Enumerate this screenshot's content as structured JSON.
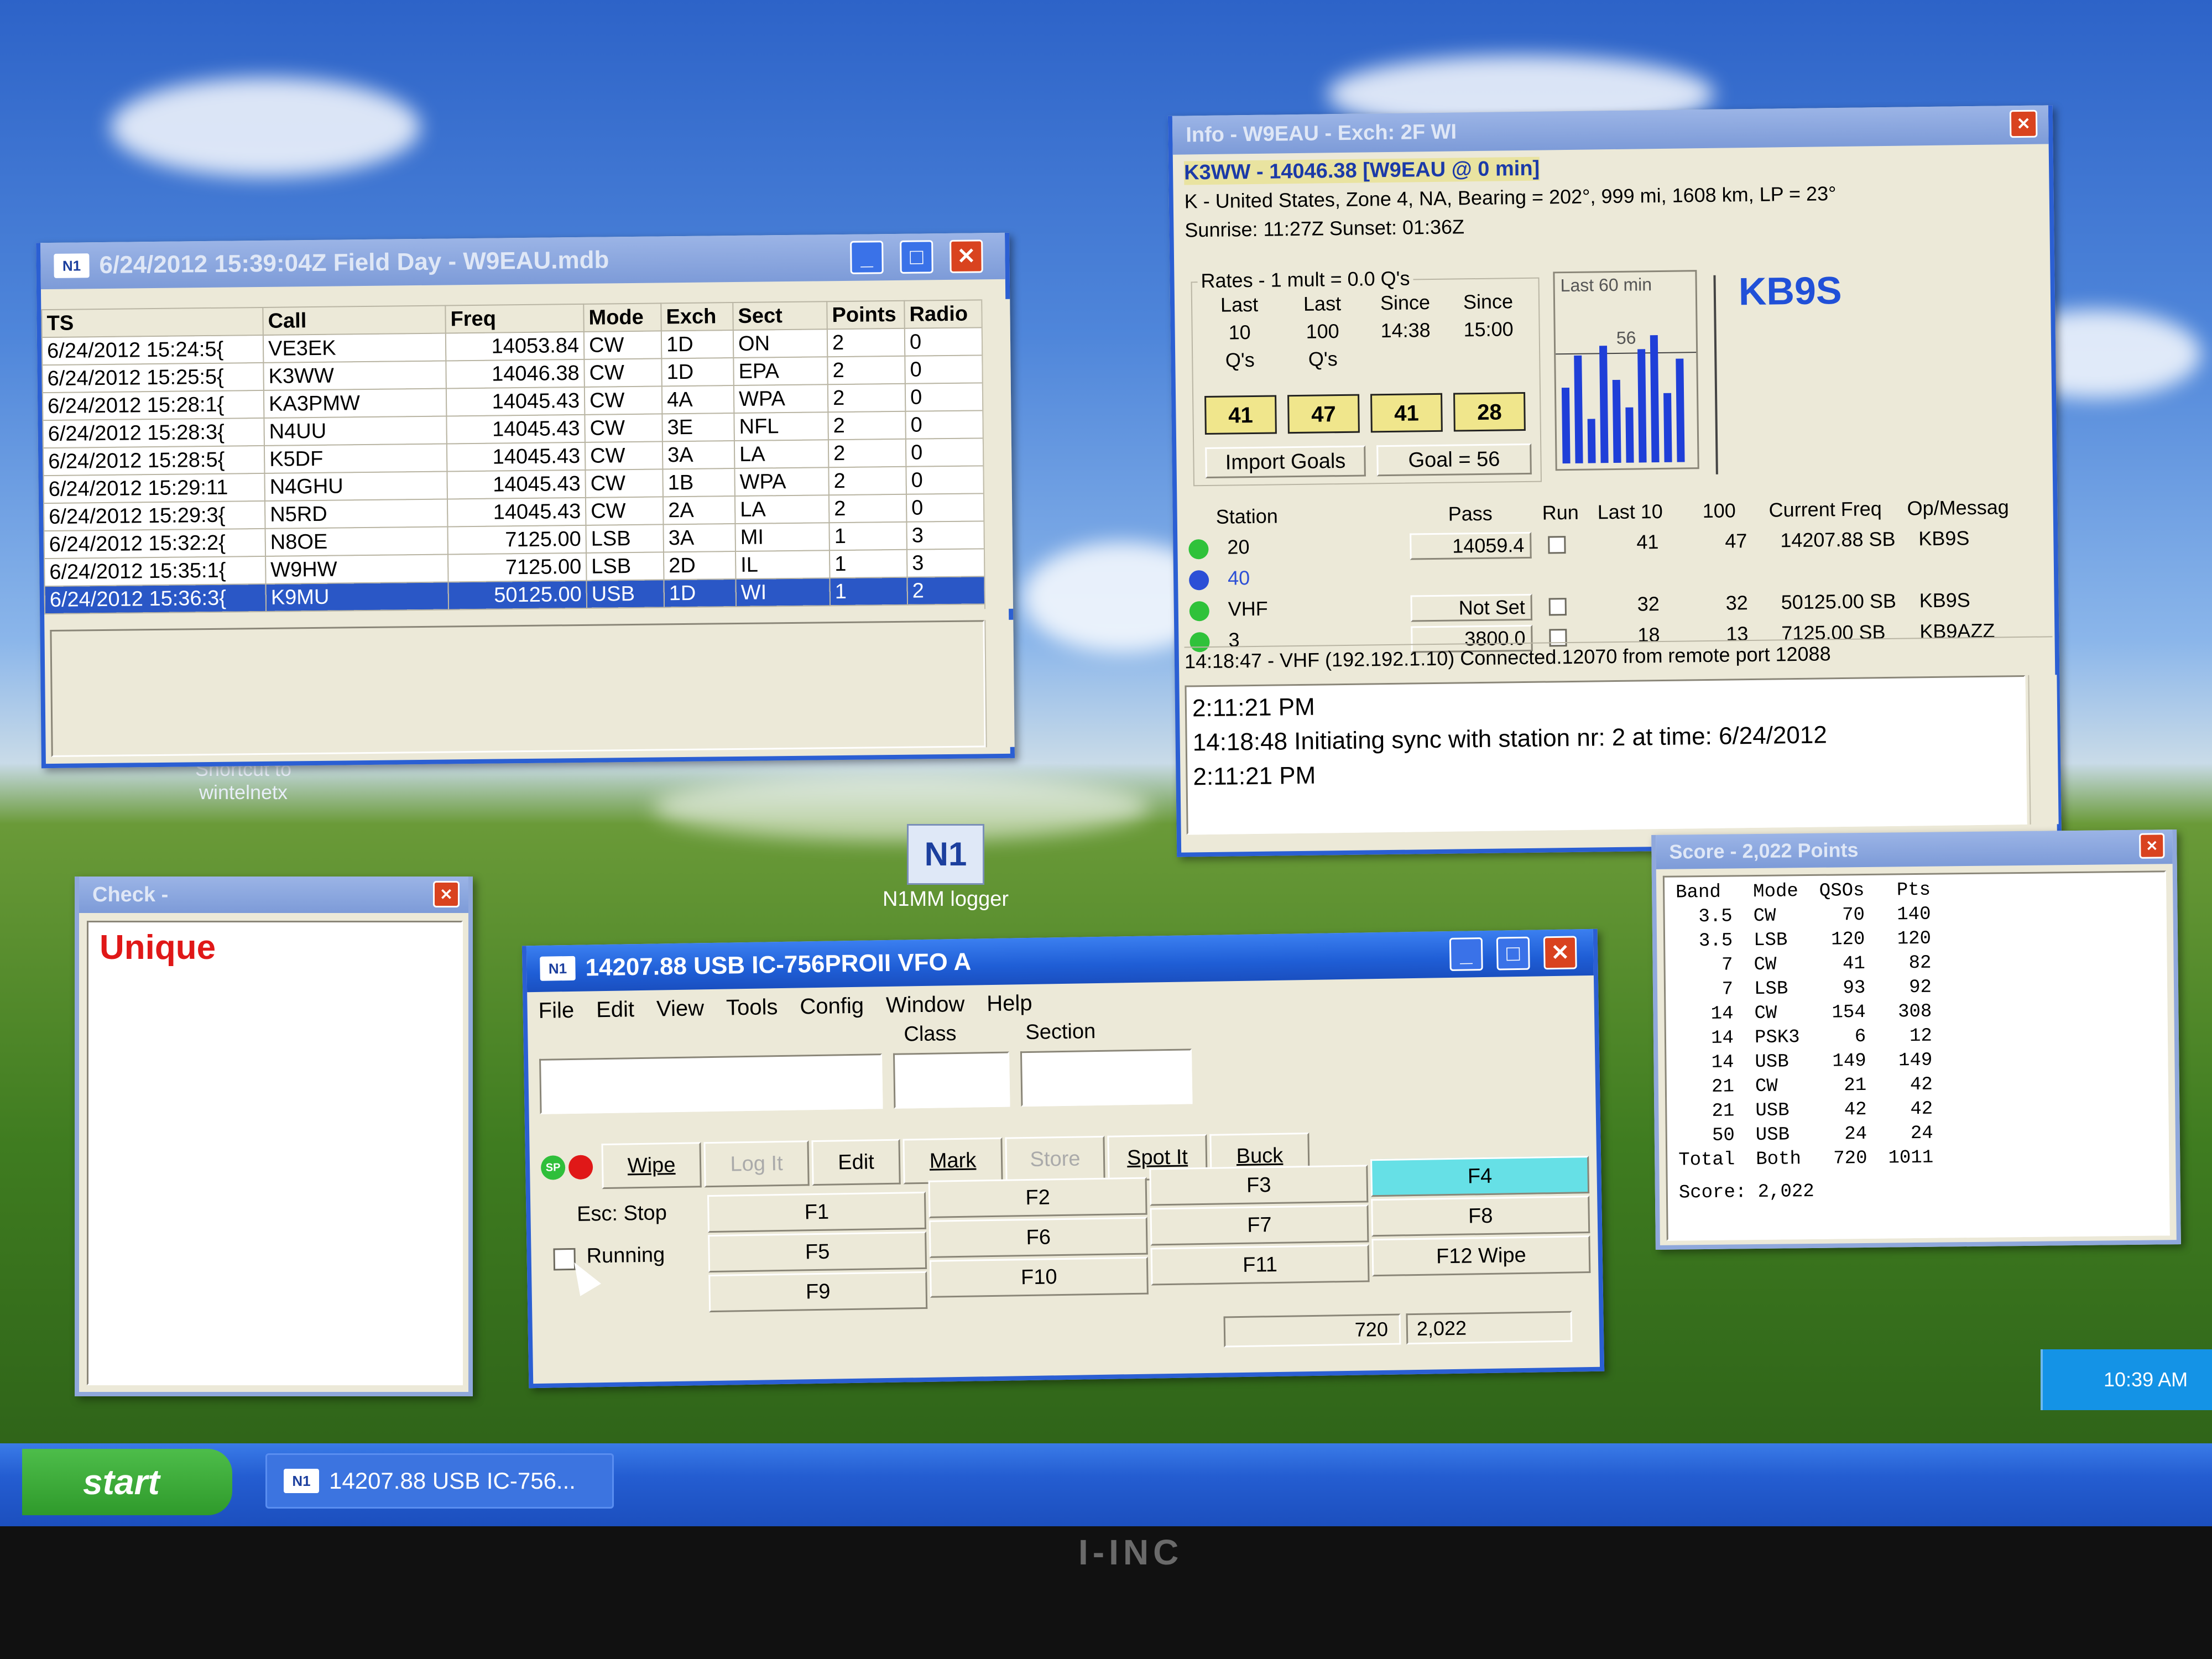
{
  "desktop": {
    "shortcut_winsimplex": "Shortcut to\nwintelnetx",
    "shortcut_n1mm": "N1MM logger"
  },
  "log_window": {
    "title": "6/24/2012 15:39:04Z  Field Day - W9EAU.mdb",
    "columns": [
      "TS",
      "Call",
      "Freq",
      "Mode",
      "Exch",
      "Sect",
      "Points",
      "Radio"
    ],
    "rows": [
      [
        "6/24/2012 15:24:5{",
        "VE3EK",
        "14053.84",
        "CW",
        "1D",
        "ON",
        "2",
        "0"
      ],
      [
        "6/24/2012 15:25:5{",
        "K3WW",
        "14046.38",
        "CW",
        "1D",
        "EPA",
        "2",
        "0"
      ],
      [
        "6/24/2012 15:28:1{",
        "KA3PMW",
        "14045.43",
        "CW",
        "4A",
        "WPA",
        "2",
        "0"
      ],
      [
        "6/24/2012 15:28:3{",
        "N4UU",
        "14045.43",
        "CW",
        "3E",
        "NFL",
        "2",
        "0"
      ],
      [
        "6/24/2012 15:28:5{",
        "K5DF",
        "14045.43",
        "CW",
        "3A",
        "LA",
        "2",
        "0"
      ],
      [
        "6/24/2012 15:29:11",
        "N4GHU",
        "14045.43",
        "CW",
        "1B",
        "WPA",
        "2",
        "0"
      ],
      [
        "6/24/2012 15:29:3{",
        "N5RD",
        "14045.43",
        "CW",
        "2A",
        "LA",
        "2",
        "0"
      ],
      [
        "6/24/2012 15:32:2{",
        "N8OE",
        "7125.00",
        "LSB",
        "3A",
        "MI",
        "1",
        "3"
      ],
      [
        "6/24/2012 15:35:1{",
        "W9HW",
        "7125.00",
        "LSB",
        "2D",
        "IL",
        "1",
        "3"
      ],
      [
        "6/24/2012 15:36:3{",
        "K9MU",
        "50125.00",
        "USB",
        "1D",
        "WI",
        "1",
        "2"
      ]
    ],
    "selected_row": 9
  },
  "info_window": {
    "title": "Info - W9EAU - Exch: 2F WI",
    "spot_line": "K3WW - 14046.38 [W9EAU @ 0 min]",
    "country_line": "K - United States, Zone 4, NA, Bearing = 202°, 999  mi, 1608 km, LP = 23°",
    "sun_line": "Sunrise: 11:27Z   Sunset: 01:36Z",
    "rates_label": "Rates - 1 mult = 0.0 Q's",
    "rate_headers": [
      [
        "Last",
        "10",
        "Q's"
      ],
      [
        "Last",
        "100",
        "Q's"
      ],
      [
        "Since",
        "14:38",
        ""
      ],
      [
        "Since",
        "15:00",
        ""
      ]
    ],
    "rate_values": [
      "41",
      "47",
      "41",
      "28"
    ],
    "import_goals": "Import Goals",
    "goal": "Goal = 56",
    "graph_label": "Last 60 min",
    "graph_goal": "56",
    "graph_bars": [
      0.55,
      0.78,
      0.32,
      0.85,
      0.6,
      0.4,
      0.82,
      0.92,
      0.5,
      0.75
    ],
    "operator": "KB9S",
    "station_headers": [
      "Station",
      "Pass",
      "Run",
      "Last 10",
      "100",
      "Current Freq",
      "Op/Messag"
    ],
    "stations": [
      {
        "dot": "#2fc23a",
        "name": "20",
        "pass": "14059.4",
        "last10": "41",
        "last100": "47",
        "freq": "14207.88 SB",
        "op": "KB9S"
      },
      {
        "dot": "#2c4fd6",
        "name": "40",
        "pass": "",
        "last10": "",
        "last100": "",
        "freq": "",
        "op": ""
      },
      {
        "dot": "#2fc23a",
        "name": "VHF",
        "pass": "Not Set",
        "last10": "32",
        "last100": "32",
        "freq": "50125.00 SB",
        "op": "KB9S"
      },
      {
        "dot": "#2fc23a",
        "name": "3",
        "pass": "3800.0",
        "last10": "18",
        "last100": "13",
        "freq": "7125.00 SB",
        "op": "KB9AZZ"
      }
    ],
    "status": "14:18:47 - VHF (192.192.1.10) Connected.12070 from remote port 12088",
    "messages": [
      "2:11:21 PM",
      "14:18:48 Initiating sync with station nr: 2 at time: 6/24/2012",
      "2:11:21 PM"
    ]
  },
  "check_window": {
    "title": "Check -",
    "result": "Unique"
  },
  "score_window": {
    "title": "Score - 2,022 Points",
    "headers": [
      "Band",
      "Mode",
      "QSOs",
      "Pts"
    ],
    "rows": [
      [
        "3.5",
        "CW",
        "70",
        "140"
      ],
      [
        "3.5",
        "LSB",
        "120",
        "120"
      ],
      [
        "7",
        "CW",
        "41",
        "82"
      ],
      [
        "7",
        "LSB",
        "93",
        "92"
      ],
      [
        "14",
        "CW",
        "154",
        "308"
      ],
      [
        "14",
        "PSK3",
        "6",
        "12"
      ],
      [
        "14",
        "USB",
        "149",
        "149"
      ],
      [
        "21",
        "CW",
        "21",
        "42"
      ],
      [
        "21",
        "USB",
        "42",
        "42"
      ],
      [
        "50",
        "USB",
        "24",
        "24"
      ],
      [
        "Total",
        "Both",
        "720",
        "1011"
      ]
    ],
    "score_line": "Score: 2,022"
  },
  "entry_window": {
    "title": "14207.88 USB IC-756PROII VFO A",
    "menu": [
      "File",
      "Edit",
      "View",
      "Tools",
      "Config",
      "Window",
      "Help"
    ],
    "class_label": "Class",
    "section_label": "Section",
    "buttons": {
      "sp": "SP",
      "wipe": "Wipe",
      "logit": "Log It",
      "edit": "Edit",
      "mark": "Mark",
      "store": "Store",
      "spotit": "Spot It",
      "buck": "Buck"
    },
    "esc_stop": "Esc: Stop",
    "running": "Running",
    "fkeys": {
      "f1": "F1",
      "f2": "F2",
      "f3": "F3",
      "f4": "F4",
      "f5": "F5",
      "f6": "F6",
      "f7": "F7",
      "f8": "F8",
      "f9": "F9",
      "f10": "F10",
      "f11": "F11",
      "f12": "F12 Wipe"
    },
    "status_qsos": "720",
    "status_score": "2,022"
  },
  "taskbar": {
    "start": "start",
    "task": "14207.88 USB IC-756...",
    "clock": "10:39 AM"
  },
  "monitor": {
    "brand": "I-INC"
  }
}
